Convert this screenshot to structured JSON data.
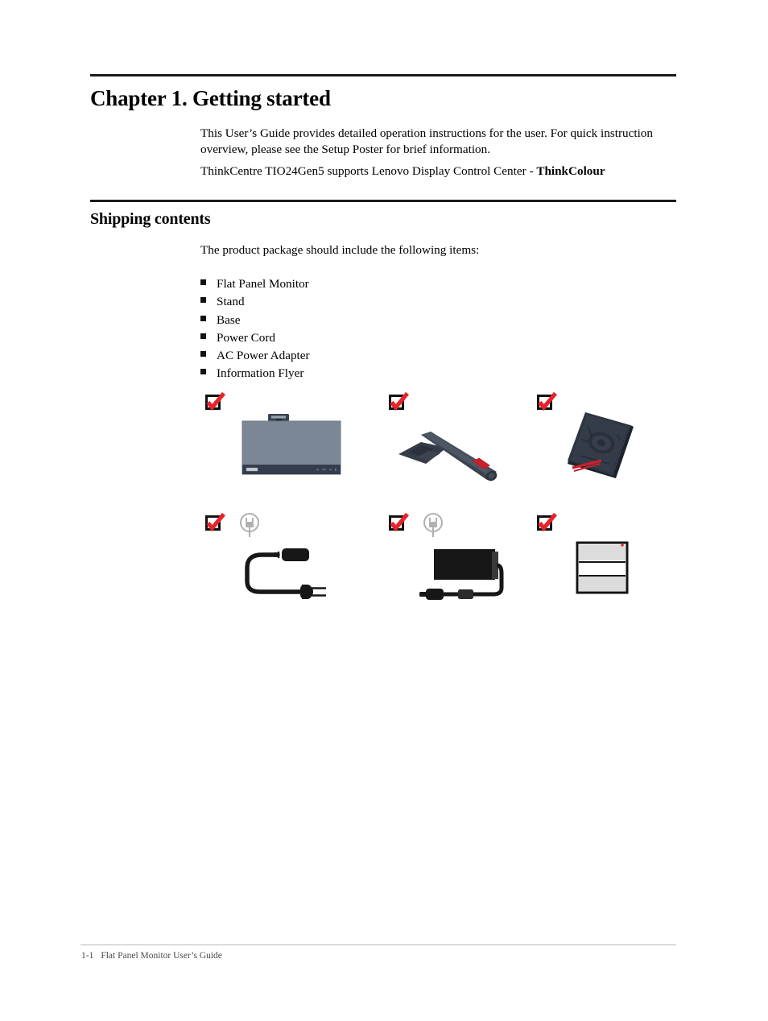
{
  "document": {
    "chapter_title": "Chapter 1. Getting started",
    "intro_paragraph": "This User’s Guide provides detailed operation instructions for the user. For quick instruction overview, please see the Setup Poster for brief information.",
    "thinkcolour_line": {
      "text": "ThinkCentre TIO24Gen5 supports Lenovo Display Control Center - ",
      "bold_text": "ThinkColour"
    },
    "section_title": "Shipping contents",
    "package_paragraph": "The product package should include the following items:",
    "bullet_items": [
      "Flat Panel Monitor",
      "Stand",
      "Base",
      "Power Cord",
      "AC Power Adapter",
      "Information Flyer"
    ],
    "illustrations": [
      {
        "name": "flat-panel-monitor",
        "checked": true,
        "has_plug_icon": false
      },
      {
        "name": "stand",
        "checked": true,
        "has_plug_icon": false
      },
      {
        "name": "base",
        "checked": true,
        "has_plug_icon": false
      },
      {
        "name": "power-cord",
        "checked": true,
        "has_plug_icon": true
      },
      {
        "name": "ac-power-adapter",
        "checked": true,
        "has_plug_icon": true
      },
      {
        "name": "information-flyer",
        "checked": true,
        "has_plug_icon": false
      }
    ],
    "footer": {
      "page_number": "1-1",
      "label": "Flat Panel Monitor User’s Guide"
    }
  },
  "colors": {
    "check_red": "#e8232a",
    "rule_black": "#1a1a1a",
    "screen_gray": "#7b8794",
    "bezel_navy": "#333d4d",
    "stand_dark": "#3c434e",
    "accent_red": "#c8202a",
    "plug_icon_gray": "#b0b0b0",
    "flyer_band": "#dcdcdc"
  }
}
